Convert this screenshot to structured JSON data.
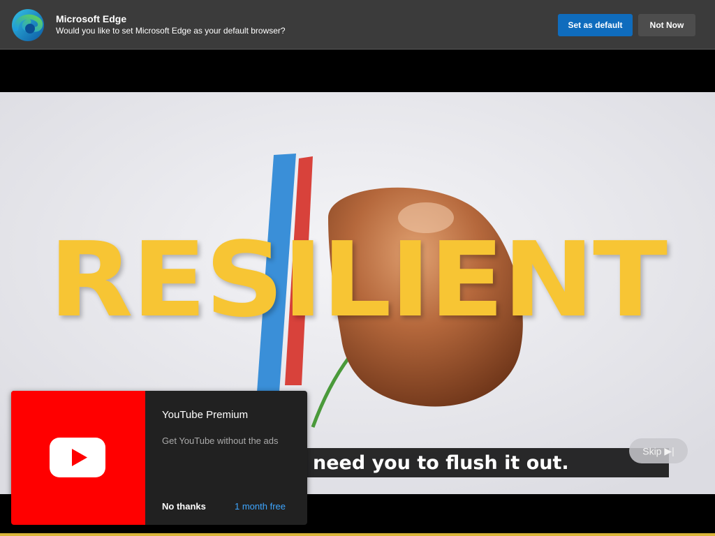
{
  "edge_prompt": {
    "title": "Microsoft Edge",
    "subtitle": "Would you like to set Microsoft Edge as your default browser?",
    "primary_label": "Set as default",
    "secondary_label": "Not Now",
    "icon": "edge-logo"
  },
  "video": {
    "headline": "RESILIENT",
    "caption": "need you to flush it out.",
    "skip_label": "Skip",
    "skip_icon": "skip-next-icon"
  },
  "premium_promo": {
    "title": "YouTube Premium",
    "subtitle": "Get YouTube without the ads",
    "decline_label": "No thanks",
    "accept_label": "1 month free",
    "icon": "youtube-logo",
    "accent": "#ff0000",
    "link_color": "#3ea6ff"
  }
}
